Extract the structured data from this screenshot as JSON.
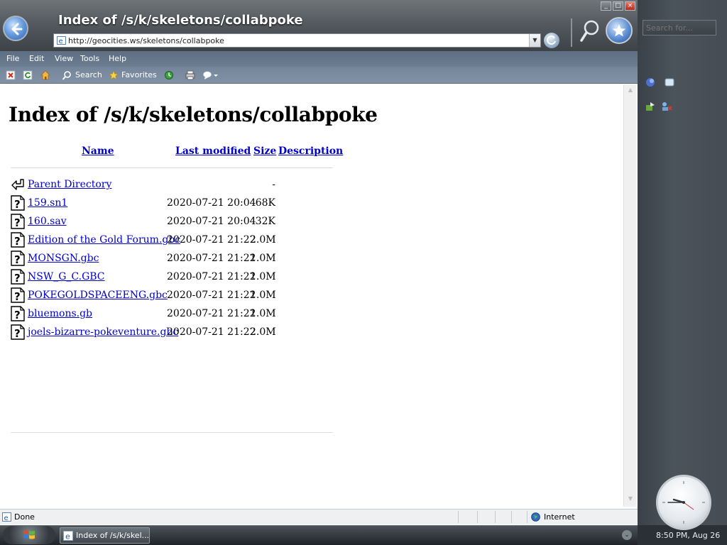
{
  "window": {
    "title": "Index of /s/k/skeletons/collabpoke",
    "controls": {
      "minimize": "_",
      "maximize": "□",
      "close": "×"
    }
  },
  "address": {
    "url": "http://geocities.ws/skeletons/collabpoke"
  },
  "menu": [
    "File",
    "Edit",
    "View",
    "Tools",
    "Help"
  ],
  "toolbar": {
    "search_label": "Search",
    "favorites_label": "Favorites"
  },
  "page": {
    "heading": "Index of /s/k/skeletons/collabpoke",
    "columns": {
      "name": "Name",
      "modified": "Last modified",
      "size": "Size",
      "description": "Description"
    },
    "parent": {
      "name": "Parent Directory",
      "size": "-"
    },
    "files": [
      {
        "name": "159.sn1",
        "modified": "2020-07-21 20:04",
        "size": "68K"
      },
      {
        "name": "160.sav",
        "modified": "2020-07-21 20:04",
        "size": "32K"
      },
      {
        "name": "Edition of the Gold Forum.gbc",
        "modified": "2020-07-21 21:22",
        "size": "2.0M"
      },
      {
        "name": "MONSGN.gbc",
        "modified": "2020-07-21 21:22",
        "size": "1.0M"
      },
      {
        "name": "NSW_G_C.GBC",
        "modified": "2020-07-21 21:22",
        "size": "1.0M"
      },
      {
        "name": "POKEGOLDSPACEENG.gbc",
        "modified": "2020-07-21 21:22",
        "size": "1.0M"
      },
      {
        "name": "bluemons.gb",
        "modified": "2020-07-21 21:22",
        "size": "1.0M"
      },
      {
        "name": "joels-bizarre-pokeventure.gbc",
        "modified": "2020-07-21 21:22",
        "size": "2.0M"
      }
    ]
  },
  "status": {
    "text": "Done",
    "zone": "Internet"
  },
  "sidebar": {
    "search_placeholder": "Search for...",
    "clock_label": "8:50 PM, Aug 26"
  },
  "taskbar": {
    "task_label": "Index of /s/k/skel..."
  }
}
